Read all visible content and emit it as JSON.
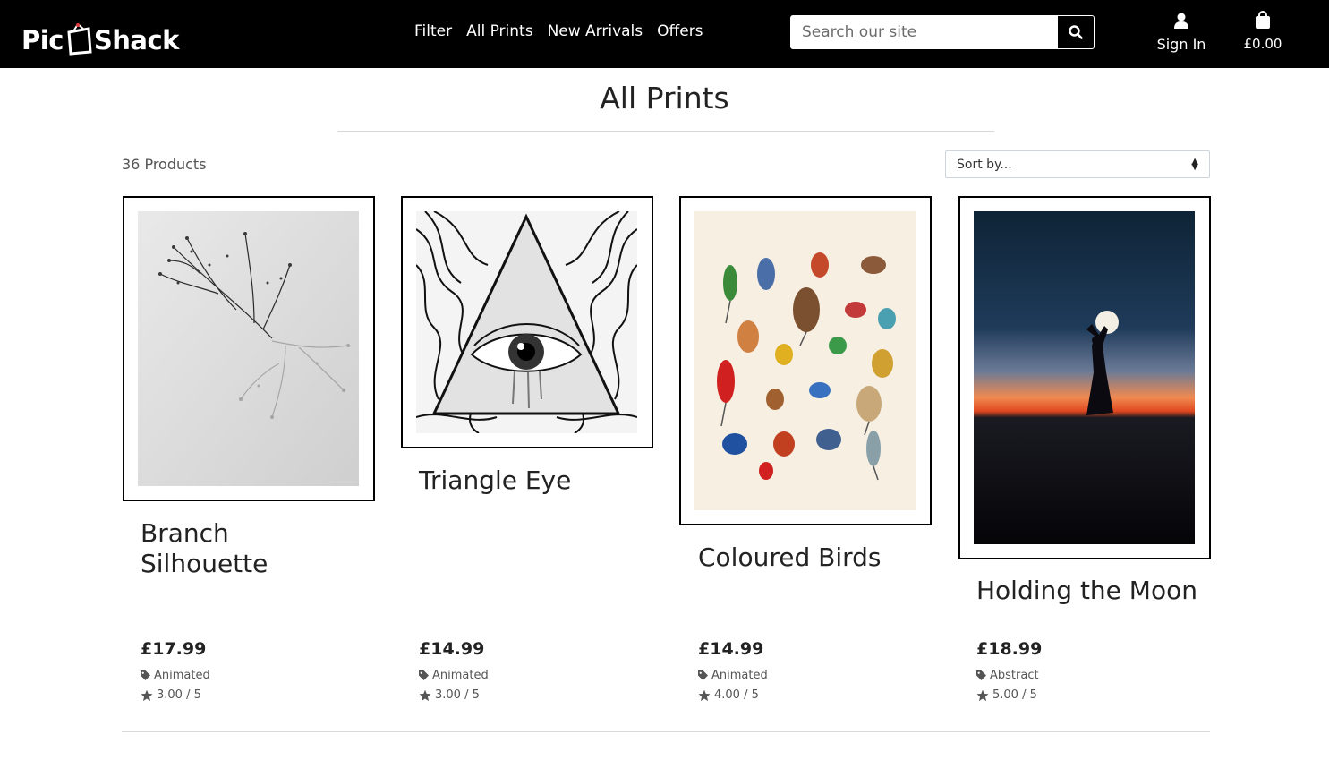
{
  "header": {
    "logo_left": "Pic",
    "logo_right": "Shack",
    "nav": [
      "Filter",
      "All Prints",
      "New Arrivals",
      "Offers"
    ],
    "search_placeholder": "Search our site",
    "account_label": "Sign In",
    "bag_total": "£0.00"
  },
  "page": {
    "title": "All Prints",
    "product_count": "36 Products",
    "sort_label": "Sort by..."
  },
  "products": [
    {
      "name": "Branch Silhouette",
      "price": "£17.99",
      "category": "Animated",
      "rating": "3.00 / 5"
    },
    {
      "name": "Triangle Eye",
      "price": "£14.99",
      "category": "Animated",
      "rating": "3.00 / 5"
    },
    {
      "name": "Coloured Birds",
      "price": "£14.99",
      "category": "Animated",
      "rating": "4.00 / 5"
    },
    {
      "name": "Holding the Moon",
      "price": "£18.99",
      "category": "Abstract",
      "rating": "5.00 / 5"
    }
  ],
  "colors": {
    "header_bg": "#000000",
    "text": "#222222",
    "muted": "#555555"
  }
}
